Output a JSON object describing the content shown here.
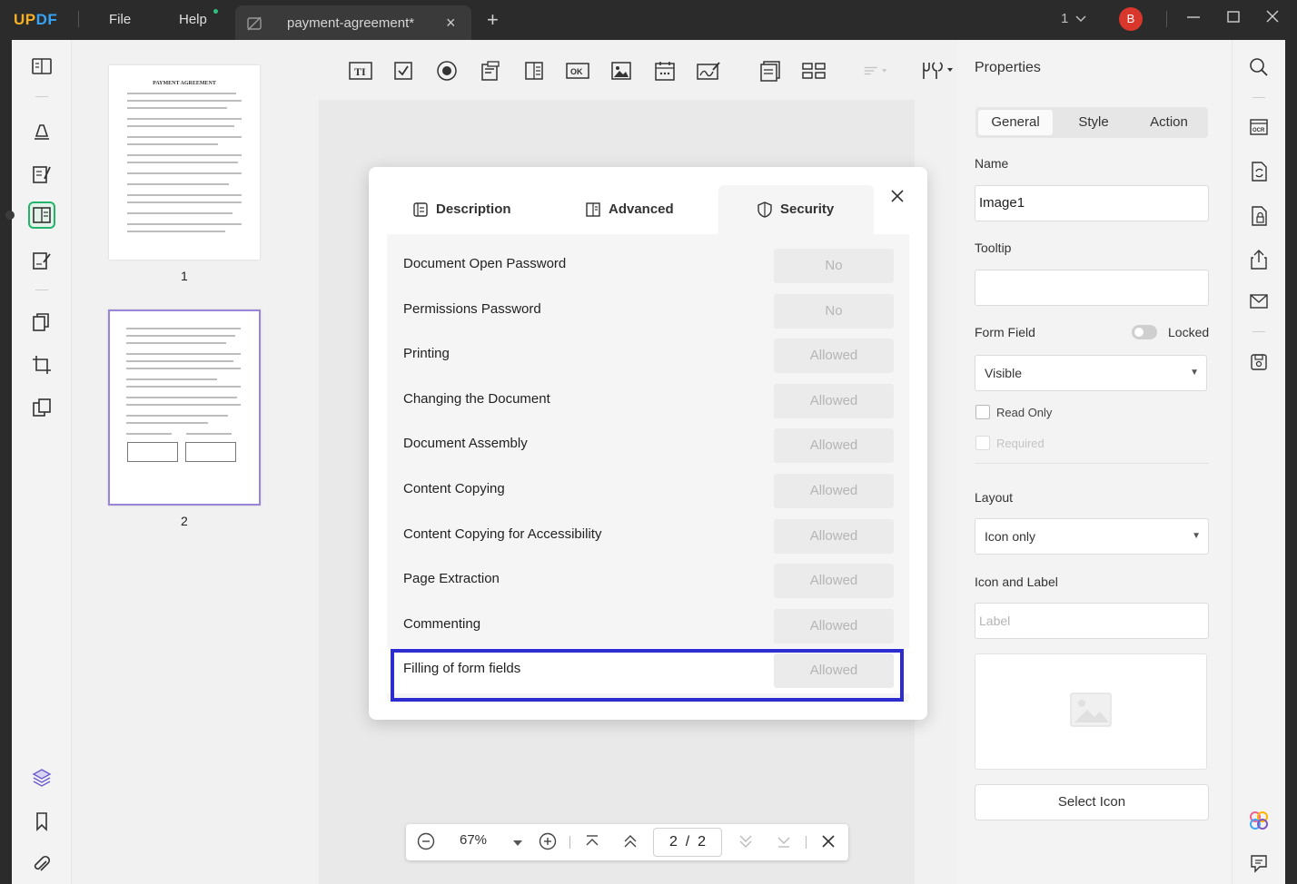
{
  "titlebar": {
    "logo_a": "UP",
    "logo_b": "DF",
    "menu": [
      "File",
      "Help"
    ],
    "tab_title": "payment-agreement*",
    "tab_close": "×",
    "tab_add": "+",
    "page_selector": "1",
    "avatar_initial": "B"
  },
  "thumbnails": {
    "pages": [
      {
        "number": "1",
        "heading": "PAYMENT AGREEMENT"
      },
      {
        "number": "2"
      }
    ]
  },
  "page_nav": {
    "zoom": "67%",
    "current_page": "2",
    "page_sep": "/",
    "total_pages": "2"
  },
  "properties": {
    "title": "Properties",
    "tabs": [
      "General",
      "Style",
      "Action"
    ],
    "name_label": "Name",
    "name_value": "Image1",
    "tooltip_label": "Tooltip",
    "tooltip_value": "",
    "form_field_label": "Form Field",
    "locked_label": "Locked",
    "visibility_value": "Visible",
    "read_only_label": "Read Only",
    "required_label": "Required",
    "layout_label": "Layout",
    "layout_value": "Icon only",
    "icon_label_heading": "Icon and Label",
    "label_placeholder": "Label",
    "select_icon_label": "Select Icon"
  },
  "dialog": {
    "tabs": [
      "Description",
      "Advanced",
      "Security"
    ],
    "active_tab": "Security",
    "rows": [
      {
        "label": "Document Open Password",
        "value": "No"
      },
      {
        "label": "Permissions Password",
        "value": "No"
      },
      {
        "label": "Printing",
        "value": "Allowed"
      },
      {
        "label": "Changing the Document",
        "value": "Allowed"
      },
      {
        "label": "Document Assembly",
        "value": "Allowed"
      },
      {
        "label": "Content Copying",
        "value": "Allowed"
      },
      {
        "label": "Content Copying for Accessibility",
        "value": "Allowed"
      },
      {
        "label": "Page Extraction",
        "value": "Allowed"
      },
      {
        "label": "Commenting",
        "value": "Allowed"
      },
      {
        "label": "Filling of form fields",
        "value": "Allowed"
      }
    ],
    "highlighted_row": 9
  },
  "colors": {
    "accent_green": "#23b36a",
    "highlight_blue": "#2c2ccf",
    "avatar_red": "#d9372b"
  }
}
